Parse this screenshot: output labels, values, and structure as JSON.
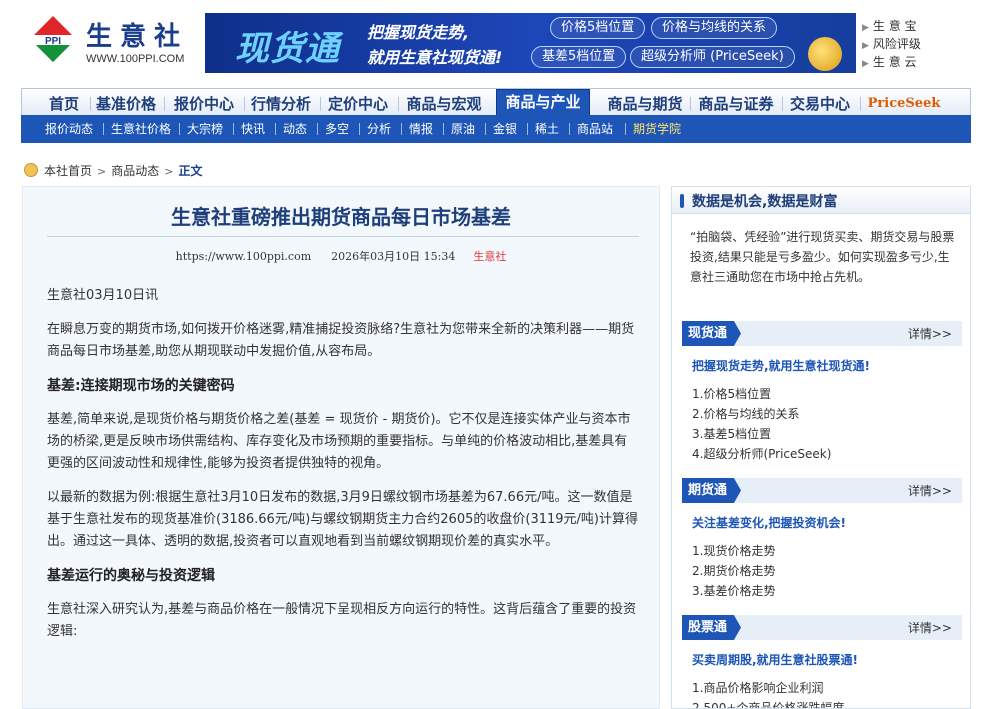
{
  "header": {
    "brand_name": "生意社",
    "brand_url": "WWW.100PPI.COM",
    "logo_text": "PPI",
    "banner": {
      "product": "现货通",
      "slogan1": "把握现货走势,",
      "slogan2": "就用生意社现货通!",
      "pills": [
        "价格5档位置",
        "价格与均线的关系",
        "基差5档位置",
        "超级分析师 (PriceSeek)"
      ]
    },
    "quick_links": [
      "生 意 宝",
      "风险评级",
      "生 意 云"
    ]
  },
  "nav": {
    "main": [
      "首页",
      "基准价格",
      "报价中心",
      "行情分析",
      "定价中心",
      "商品与宏观",
      "商品与产业",
      "商品与期货",
      "商品与证券",
      "交易中心",
      "PriceSeek"
    ],
    "active_index": 6,
    "sub": [
      "报价动态",
      "生意社价格",
      "大宗榜",
      "快讯",
      "动态",
      "多空",
      "分析",
      "情报",
      "原油",
      "金银",
      "稀土",
      "商品站",
      "期货学院"
    ]
  },
  "breadcrumb": {
    "home": "本社首页",
    "section": "商品动态",
    "current": "正文"
  },
  "article": {
    "title": "生意社重磅推出期货商品每日市场基差",
    "url": "https://www.100ppi.com",
    "date": "2026年03月10日 15:34",
    "source": "生意社",
    "p1": "生意社03月10日讯",
    "p2": "在瞬息万变的期货市场,如何拨开价格迷雾,精准捕捉投资脉络?生意社为您带来全新的决策利器——期货商品每日市场基差,助您从期现联动中发掘价值,从容布局。",
    "h1": "基差:连接期现市场的关键密码",
    "p3": "基差,简单来说,是现货价格与期货价格之差(基差 = 现货价 - 期货价)。它不仅是连接实体产业与资本市场的桥梁,更是反映市场供需结构、库存变化及市场预期的重要指标。与单纯的价格波动相比,基差具有更强的区间波动性和规律性,能够为投资者提供独特的视角。",
    "p4": "以最新的数据为例:根据生意社3月10日发布的数据,3月9日螺纹钢市场基差为67.66元/吨。这一数值是基于生意社发布的现货基准价(3186.66元/吨)与螺纹钢期货主力合约2605的收盘价(3119元/吨)计算得出。通过这一具体、透明的数据,投资者可以直观地看到当前螺纹钢期现价差的真实水平。",
    "h2": "基差运行的奥秘与投资逻辑",
    "p5": "生意社深入研究认为,基差与商品价格在一般情况下呈现相反方向运行的特性。这背后蕴含了重要的投资逻辑:"
  },
  "sidebar": {
    "title": "数据是机会,数据是财富",
    "intro": "“拍脑袋、凭经验”进行现货买卖、期货交易与股票投资,结果只能是亏多盈少。如何实现盈多亏少,生意社三通助您在市场中抢占先机。",
    "more_label": "详情>>",
    "sections": [
      {
        "tag": "现货通",
        "slogan": "把握现货走势,就用生意社现货通!",
        "items": [
          "1.价格5档位置",
          "2.价格与均线的关系",
          "3.基差5档位置",
          "4.超级分析师(PriceSeek)"
        ]
      },
      {
        "tag": "期货通",
        "slogan": "关注基差变化,把握投资机会!",
        "items": [
          "1.现货价格走势",
          "2.期货价格走势",
          "3.基差价格走势"
        ]
      },
      {
        "tag": "股票通",
        "slogan": "买卖周期股,就用生意社股票通!",
        "items": [
          "1.商品价格影响企业利润",
          "2.500+个商品价格涨跌幅度"
        ]
      }
    ]
  },
  "colors": {
    "brand_blue": "#1e56b8",
    "nav_text": "#1f3f7a",
    "source_red": "#e03a3a",
    "highlight_yellow": "#ffe46b",
    "priceseek_orange": "#e05a00"
  }
}
